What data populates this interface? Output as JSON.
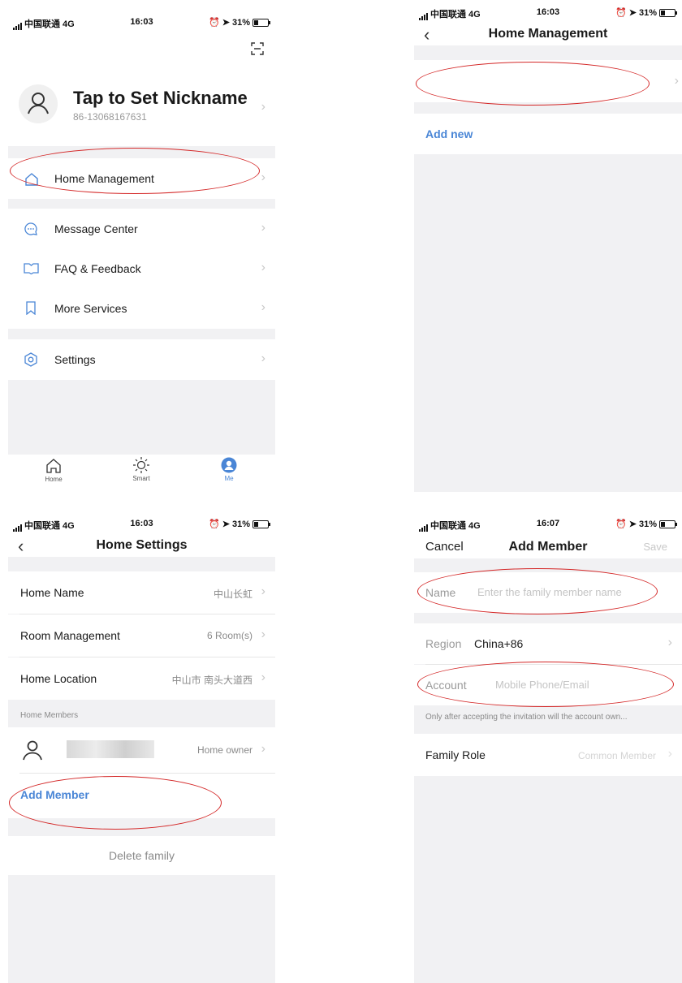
{
  "colors": {
    "accent": "#4a86d6",
    "annotation": "#d42828",
    "background": "#f1f1f3"
  },
  "status_bars": [
    {
      "carrier": "中国联通 4G",
      "time": "16:03",
      "battery": "31%"
    },
    {
      "carrier": "中国联通 4G",
      "time": "16:03",
      "battery": "31%"
    },
    {
      "carrier": "中国联通 4G",
      "time": "16:03",
      "battery": "31%"
    },
    {
      "carrier": "中国联通 4G",
      "time": "16:07",
      "battery": "31%"
    }
  ],
  "me_screen": {
    "scan_icon": "scan-icon",
    "profile": {
      "nickname": "Tap to Set Nickname",
      "phone": "86-13068167631"
    },
    "menu": [
      {
        "label": "Home Management",
        "icon": "house-icon"
      },
      {
        "label": "Message Center",
        "icon": "message-icon"
      },
      {
        "label": "FAQ & Feedback",
        "icon": "book-icon"
      },
      {
        "label": "More Services",
        "icon": "bookmark-icon"
      },
      {
        "label": "Settings",
        "icon": "settings-icon"
      }
    ],
    "tabbar": [
      {
        "label": "Home",
        "icon": "home-tab-icon",
        "active": false
      },
      {
        "label": "Smart",
        "icon": "sun-icon",
        "active": false
      },
      {
        "label": "Me",
        "icon": "user-tab-icon",
        "active": true
      }
    ]
  },
  "home_management": {
    "title": "Home Management",
    "add_new": "Add new"
  },
  "home_settings": {
    "title": "Home Settings",
    "rows": [
      {
        "label": "Home Name",
        "value": "中山长虹"
      },
      {
        "label": "Room Management",
        "value": "6 Room(s)"
      },
      {
        "label": "Home Location",
        "value": "中山市 南头大道西"
      }
    ],
    "members_header": "Home Members",
    "member_role": "Home owner",
    "add_member": "Add Member",
    "delete_family": "Delete family"
  },
  "add_member": {
    "cancel": "Cancel",
    "title": "Add Member",
    "save": "Save",
    "name_label": "Name",
    "name_placeholder": "Enter the family member name",
    "region_label": "Region",
    "region_value": "China+86",
    "account_label": "Account",
    "account_placeholder": "Mobile Phone/Email",
    "note": "Only after accepting the invitation will the account own...",
    "role_label": "Family Role",
    "role_value": "Common Member"
  }
}
